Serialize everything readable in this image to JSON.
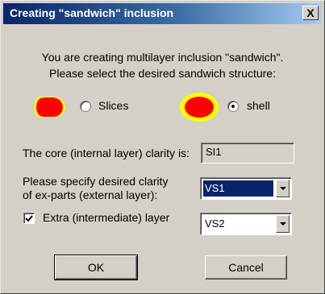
{
  "window": {
    "title": "Creating \"sandwich\" inclusion",
    "close_label": "X"
  },
  "intro": {
    "line1": "You are creating multilayer inclusion \"sandwich\".",
    "line2": "Please select the desired sandwich structure:"
  },
  "structure": {
    "options": [
      {
        "label": "Slices",
        "selected": false,
        "icon": "slices-icon"
      },
      {
        "label": "shell",
        "selected": true,
        "icon": "shell-icon"
      }
    ],
    "colors": {
      "core": "#ff0000",
      "outer": "#ffff00"
    }
  },
  "core": {
    "label": "The core (internal layer) clarity is:",
    "value": "SI1"
  },
  "external": {
    "label_line1": "Please specify desired clarity",
    "label_line2": "of ex-parts (external layer):",
    "value": "VS1"
  },
  "extra": {
    "checked": true,
    "label": "Extra (intermediate) layer",
    "value": "VS2"
  },
  "buttons": {
    "ok": "OK",
    "cancel": "Cancel"
  }
}
